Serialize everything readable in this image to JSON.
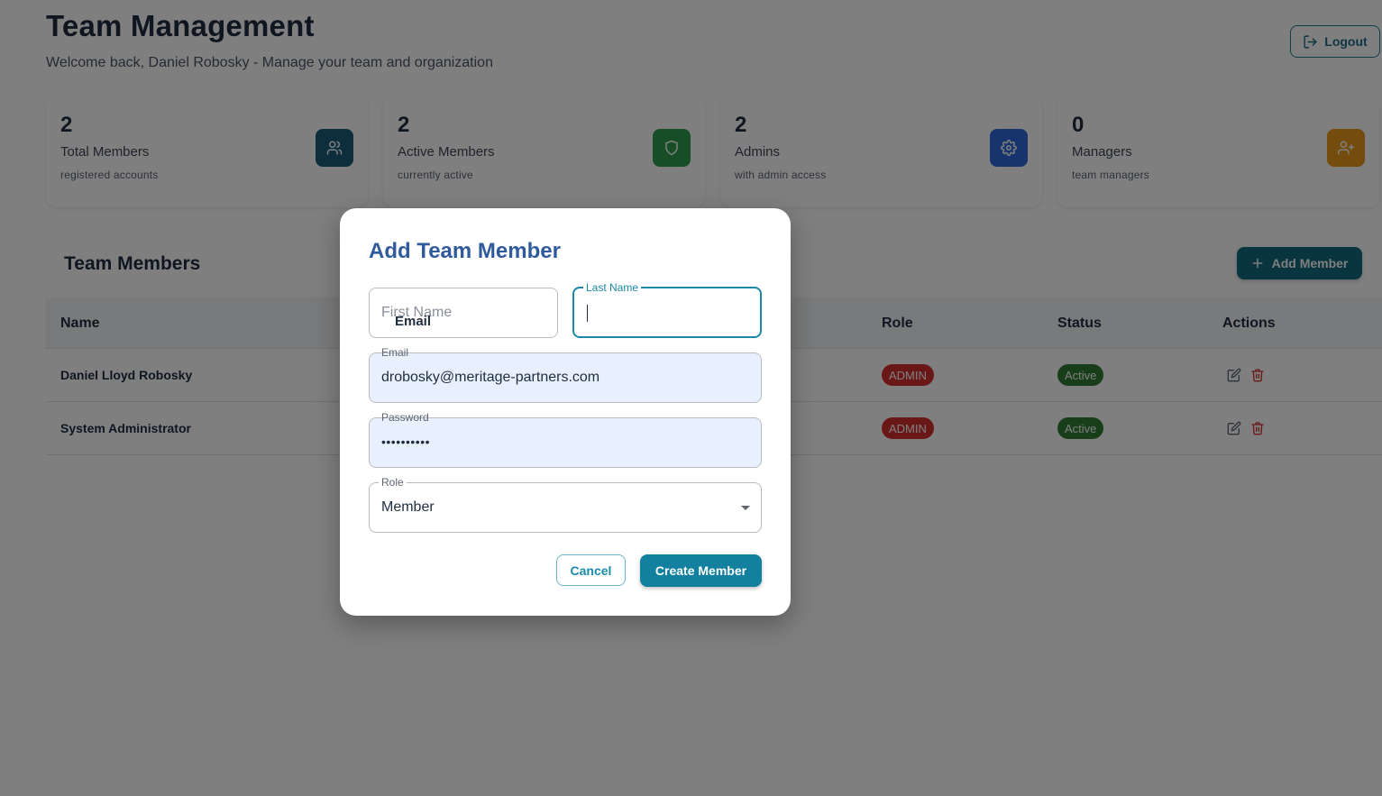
{
  "header": {
    "title": "Team Management",
    "subtitle": "Welcome back, Daniel Robosky - Manage your team and organization",
    "logout_label": "Logout"
  },
  "stats": [
    {
      "value": "2",
      "label": "Total Members",
      "sub": "registered accounts",
      "color": "#1b5e7a",
      "icon": "users-icon"
    },
    {
      "value": "2",
      "label": "Active Members",
      "sub": "currently active",
      "color": "#2e9d4e",
      "icon": "shield-icon"
    },
    {
      "value": "2",
      "label": "Admins",
      "sub": "with admin access",
      "color": "#2f6bd8",
      "icon": "gear-icon"
    },
    {
      "value": "0",
      "label": "Managers",
      "sub": "team managers",
      "color": "#e99a1c",
      "icon": "user-plus-icon"
    }
  ],
  "members": {
    "title": "Team Members",
    "add_label": "Add Member",
    "columns": {
      "name": "Name",
      "role": "Role",
      "status": "Status",
      "actions": "Actions"
    },
    "rows": [
      {
        "name": "Daniel Lloyd Robosky",
        "role": "ADMIN",
        "status": "Active"
      },
      {
        "name": "System Administrator",
        "role": "ADMIN",
        "status": "Active"
      }
    ]
  },
  "dialog": {
    "title": "Add Team Member",
    "first_name_placeholder": "First Name",
    "last_name_label": "Last Name",
    "last_name_value": "",
    "stray_label": "Email",
    "email_label": "Email",
    "email_value": "drobosky@meritage-partners.com",
    "password_label": "Password",
    "password_value": "••••••••••",
    "role_label": "Role",
    "role_value": "Member",
    "cancel_label": "Cancel",
    "create_label": "Create Member"
  }
}
